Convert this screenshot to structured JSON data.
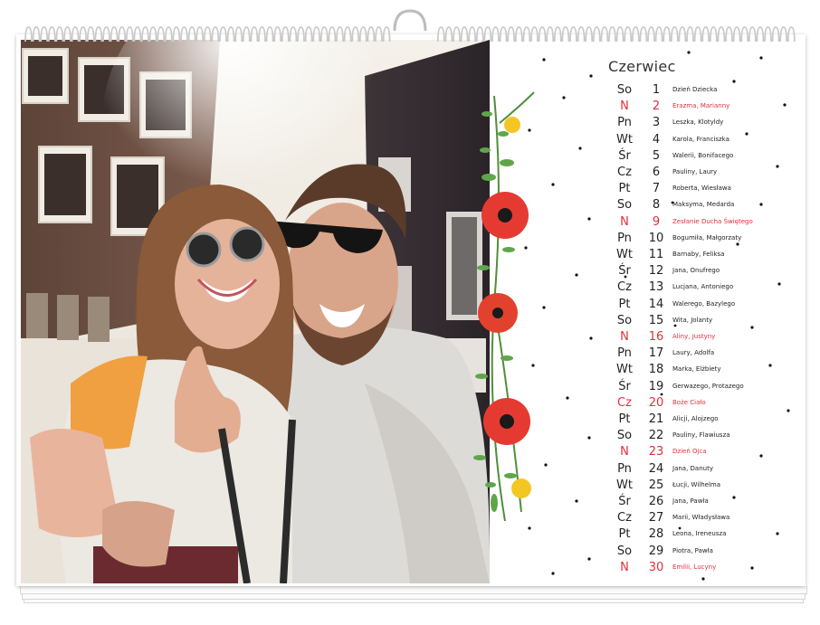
{
  "calendar": {
    "month": "Czerwiec",
    "days": [
      {
        "weekday": "So",
        "day": "1",
        "names": "Dzień Dziecka",
        "holiday": false
      },
      {
        "weekday": "N",
        "day": "2",
        "names": "Erazma, Marianny",
        "holiday": true
      },
      {
        "weekday": "Pn",
        "day": "3",
        "names": "Leszka, Klotyldy",
        "holiday": false
      },
      {
        "weekday": "Wt",
        "day": "4",
        "names": "Karola, Franciszka",
        "holiday": false
      },
      {
        "weekday": "Śr",
        "day": "5",
        "names": "Walerii, Bonifacego",
        "holiday": false
      },
      {
        "weekday": "Cz",
        "day": "6",
        "names": "Pauliny, Laury",
        "holiday": false
      },
      {
        "weekday": "Pt",
        "day": "7",
        "names": "Roberta, Wiesława",
        "holiday": false
      },
      {
        "weekday": "So",
        "day": "8",
        "names": "Maksyma, Medarda",
        "holiday": false
      },
      {
        "weekday": "N",
        "day": "9",
        "names": "Zesłanie Ducha Świętego",
        "holiday": true
      },
      {
        "weekday": "Pn",
        "day": "10",
        "names": "Bogumiła, Małgorzaty",
        "holiday": false
      },
      {
        "weekday": "Wt",
        "day": "11",
        "names": "Barnaby, Feliksa",
        "holiday": false
      },
      {
        "weekday": "Śr",
        "day": "12",
        "names": "Jana, Onufrego",
        "holiday": false
      },
      {
        "weekday": "Cz",
        "day": "13",
        "names": "Lucjana, Antoniego",
        "holiday": false
      },
      {
        "weekday": "Pt",
        "day": "14",
        "names": "Walerego, Bazylego",
        "holiday": false
      },
      {
        "weekday": "So",
        "day": "15",
        "names": "Wita, Jolanty",
        "holiday": false
      },
      {
        "weekday": "N",
        "day": "16",
        "names": "Aliny, Justyny",
        "holiday": true
      },
      {
        "weekday": "Pn",
        "day": "17",
        "names": "Laury, Adolfa",
        "holiday": false
      },
      {
        "weekday": "Wt",
        "day": "18",
        "names": "Marka, Elżbiety",
        "holiday": false
      },
      {
        "weekday": "Śr",
        "day": "19",
        "names": "Gerwazego, Protazego",
        "holiday": false
      },
      {
        "weekday": "Cz",
        "day": "20",
        "names": "Boże Ciało",
        "holiday": true
      },
      {
        "weekday": "Pt",
        "day": "21",
        "names": "Alicji, Alojzego",
        "holiday": false
      },
      {
        "weekday": "So",
        "day": "22",
        "names": "Pauliny, Flawiusza",
        "holiday": false
      },
      {
        "weekday": "N",
        "day": "23",
        "names": "Dzień Ojca",
        "holiday": true
      },
      {
        "weekday": "Pn",
        "day": "24",
        "names": "Jana, Danuty",
        "holiday": false
      },
      {
        "weekday": "Wt",
        "day": "25",
        "names": "Łucji, Wilhelma",
        "holiday": false
      },
      {
        "weekday": "Śr",
        "day": "26",
        "names": "Jana, Pawła",
        "holiday": false
      },
      {
        "weekday": "Cz",
        "day": "27",
        "names": "Marii, Władysława",
        "holiday": false
      },
      {
        "weekday": "Pt",
        "day": "28",
        "names": "Leona, Ireneusza",
        "holiday": false
      },
      {
        "weekday": "So",
        "day": "29",
        "names": "Piotra, Pawła",
        "holiday": false
      },
      {
        "weekday": "N",
        "day": "30",
        "names": "Emilii, Lucyny",
        "holiday": true
      }
    ]
  },
  "colors": {
    "holiday": "#e0303a",
    "text": "#222222",
    "binding": "#c9c9c9"
  }
}
